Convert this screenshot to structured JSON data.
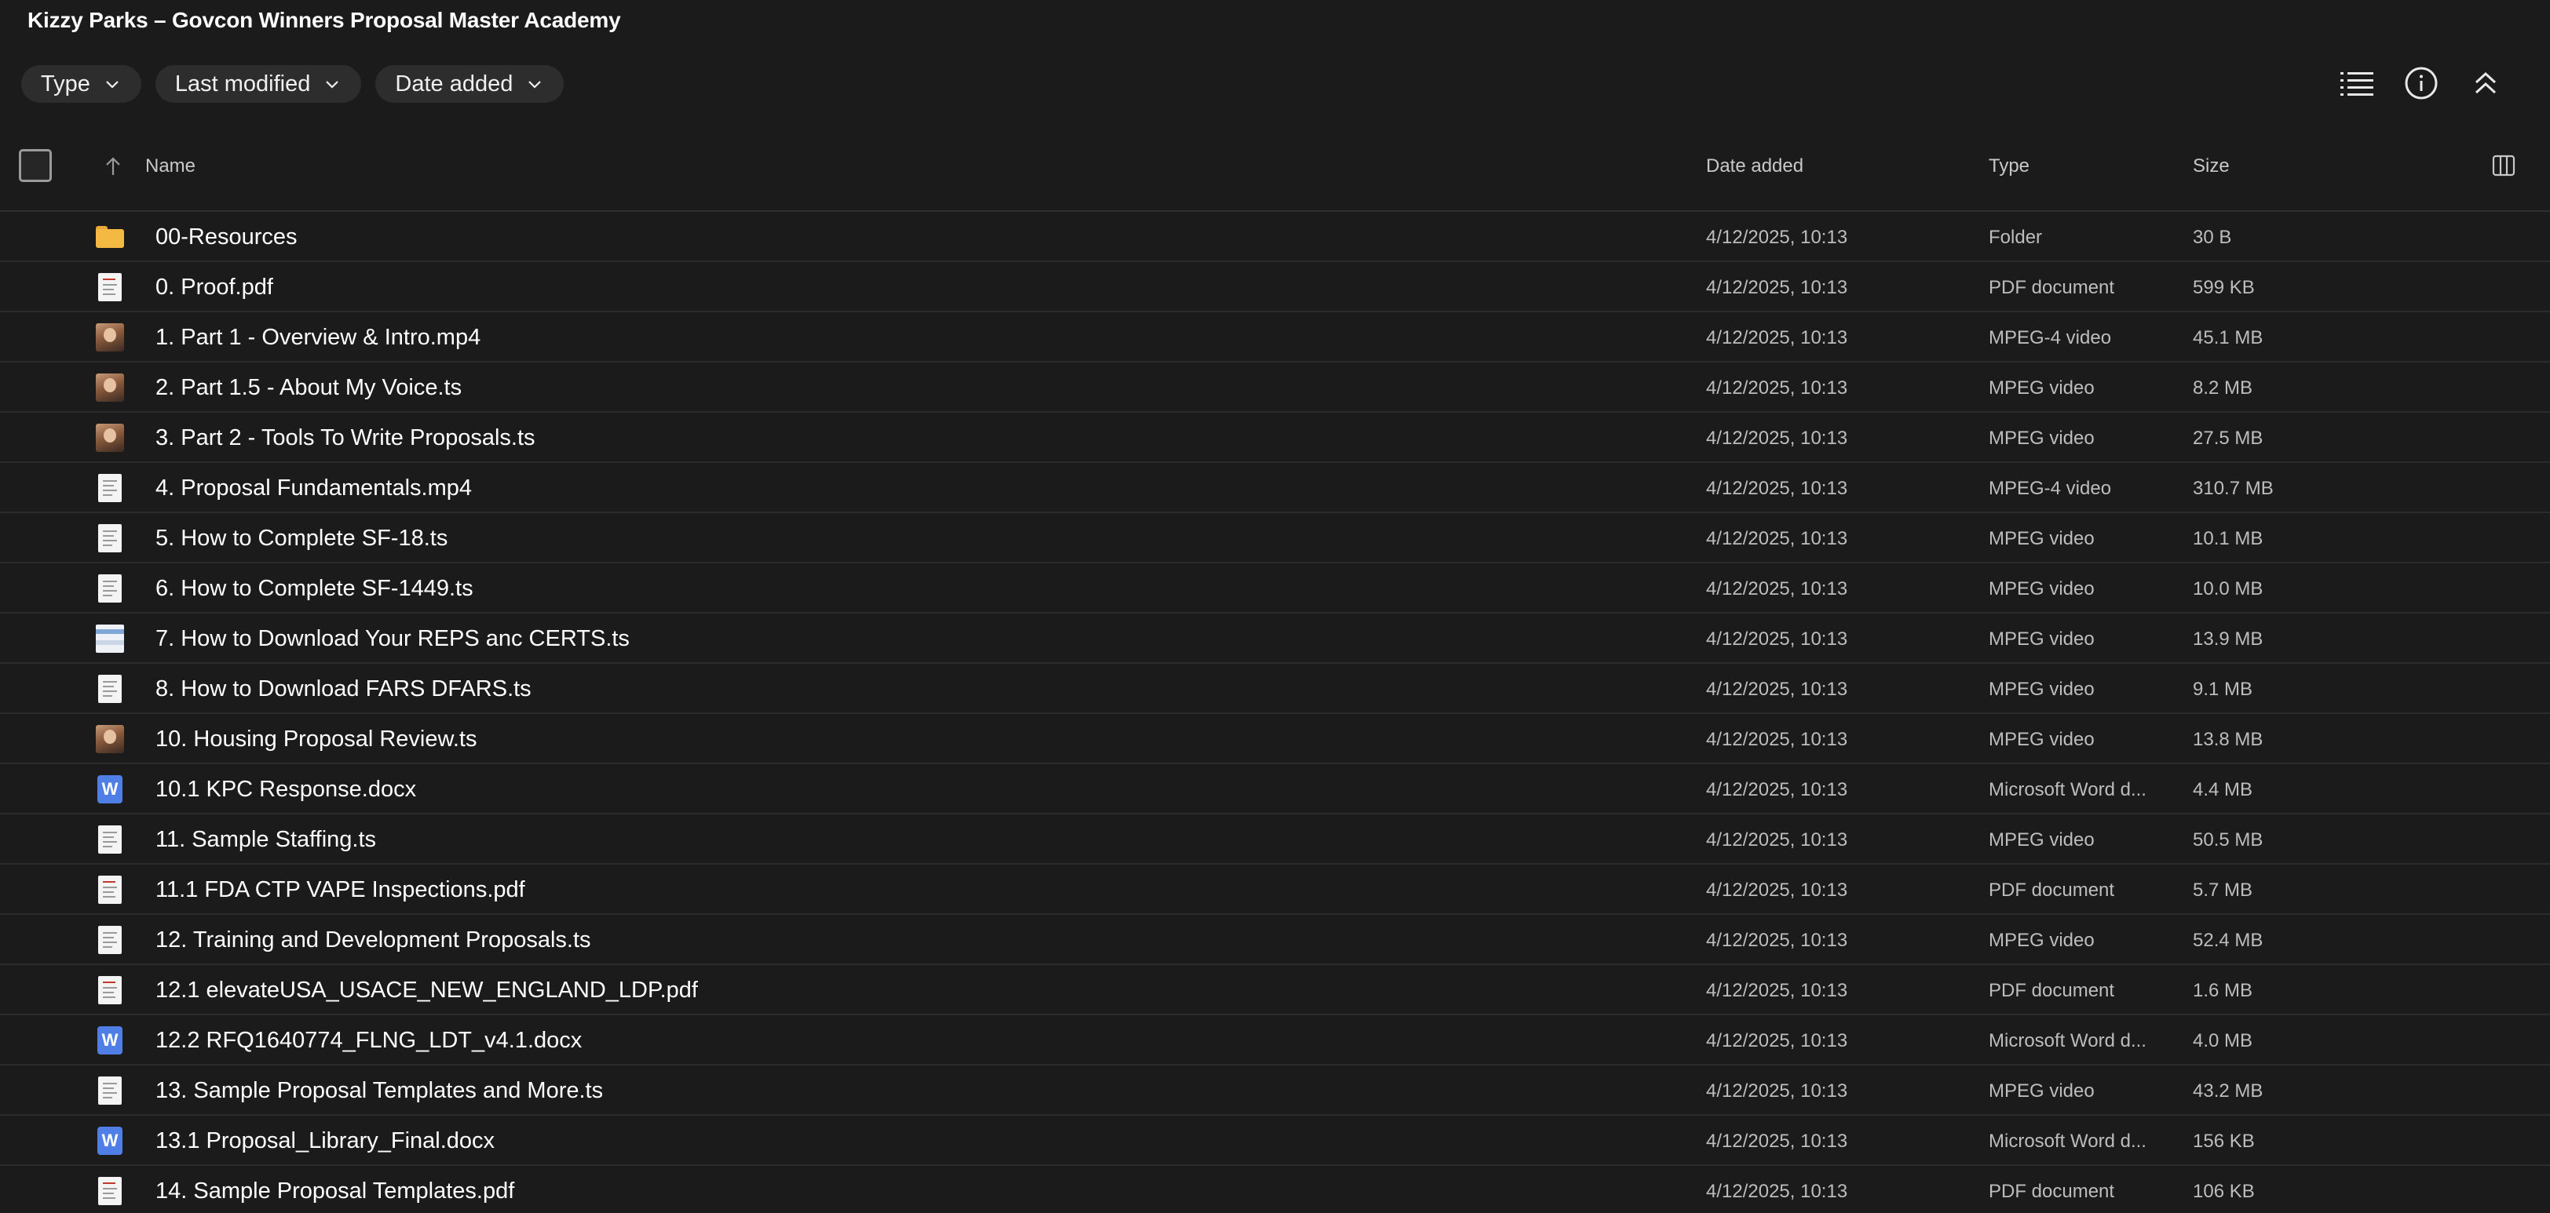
{
  "title": "Kizzy Parks – Govcon Winners Proposal Master Academy",
  "filters": [
    {
      "label": "Type"
    },
    {
      "label": "Last modified"
    },
    {
      "label": "Date added"
    }
  ],
  "columns": {
    "name": "Name",
    "date_added": "Date added",
    "type": "Type",
    "size": "Size"
  },
  "rows": [
    {
      "icon": "folder-icon",
      "name": "00-Resources",
      "date": "4/12/2025, 10:13",
      "type": "Folder",
      "size": "30 B"
    },
    {
      "icon": "pdf-thumbnail-icon",
      "name": "0. Proof.pdf",
      "date": "4/12/2025, 10:13",
      "type": "PDF document",
      "size": "599 KB"
    },
    {
      "icon": "video-thumbnail-icon",
      "name": "1. Part 1 - Overview & Intro.mp4",
      "date": "4/12/2025, 10:13",
      "type": "MPEG-4 video",
      "size": "45.1 MB"
    },
    {
      "icon": "video-thumbnail-icon",
      "name": "2. Part 1.5 - About My Voice.ts",
      "date": "4/12/2025, 10:13",
      "type": "MPEG video",
      "size": "8.2 MB"
    },
    {
      "icon": "video-thumbnail-icon",
      "name": "3. Part 2 - Tools To Write Proposals.ts",
      "date": "4/12/2025, 10:13",
      "type": "MPEG video",
      "size": "27.5 MB"
    },
    {
      "icon": "document-thumbnail-icon",
      "name": "4. Proposal Fundamentals.mp4",
      "date": "4/12/2025, 10:13",
      "type": "MPEG-4 video",
      "size": "310.7 MB"
    },
    {
      "icon": "document-thumbnail-icon",
      "name": "5. How to Complete SF-18.ts",
      "date": "4/12/2025, 10:13",
      "type": "MPEG video",
      "size": "10.1 MB"
    },
    {
      "icon": "document-thumbnail-icon",
      "name": "6. How to Complete SF-1449.ts",
      "date": "4/12/2025, 10:13",
      "type": "MPEG video",
      "size": "10.0 MB"
    },
    {
      "icon": "screenshot-thumbnail-icon",
      "name": "7. How to Download Your REPS anc CERTS.ts",
      "date": "4/12/2025, 10:13",
      "type": "MPEG video",
      "size": "13.9 MB"
    },
    {
      "icon": "document-thumbnail-icon",
      "name": "8. How to Download FARS DFARS.ts",
      "date": "4/12/2025, 10:13",
      "type": "MPEG video",
      "size": "9.1 MB"
    },
    {
      "icon": "video-thumbnail-icon",
      "name": "10. Housing Proposal Review.ts",
      "date": "4/12/2025, 10:13",
      "type": "MPEG video",
      "size": "13.8 MB"
    },
    {
      "icon": "word-icon",
      "name": "10.1 KPC Response.docx",
      "date": "4/12/2025, 10:13",
      "type": "Microsoft Word d...",
      "size": "4.4 MB"
    },
    {
      "icon": "document-thumbnail-icon",
      "name": "11. Sample Staffing.ts",
      "date": "4/12/2025, 10:13",
      "type": "MPEG video",
      "size": "50.5 MB"
    },
    {
      "icon": "pdf-thumbnail-icon",
      "name": "11.1 FDA CTP VAPE Inspections.pdf",
      "date": "4/12/2025, 10:13",
      "type": "PDF document",
      "size": "5.7 MB"
    },
    {
      "icon": "document-thumbnail-icon",
      "name": "12. Training and Development Proposals.ts",
      "date": "4/12/2025, 10:13",
      "type": "MPEG video",
      "size": "52.4 MB"
    },
    {
      "icon": "pdf-thumbnail-icon",
      "name": "12.1 elevateUSA_USACE_NEW_ENGLAND_LDP.pdf",
      "date": "4/12/2025, 10:13",
      "type": "PDF document",
      "size": "1.6 MB"
    },
    {
      "icon": "word-icon",
      "name": "12.2 RFQ1640774_FLNG_LDT_v4.1.docx",
      "date": "4/12/2025, 10:13",
      "type": "Microsoft Word d...",
      "size": "4.0 MB"
    },
    {
      "icon": "document-thumbnail-icon",
      "name": "13. Sample Proposal Templates and More.ts",
      "date": "4/12/2025, 10:13",
      "type": "MPEG video",
      "size": "43.2 MB"
    },
    {
      "icon": "word-icon",
      "name": "13.1 Proposal_Library_Final.docx",
      "date": "4/12/2025, 10:13",
      "type": "Microsoft Word d...",
      "size": "156 KB"
    },
    {
      "icon": "pdf-thumbnail-icon",
      "name": "14. Sample Proposal Templates.pdf",
      "date": "4/12/2025, 10:13",
      "type": "PDF document",
      "size": "106 KB"
    }
  ],
  "word_icon_letter": "W",
  "colors": {
    "background": "#1b1b1b",
    "chip": "#2d2d2d",
    "folder": "#f4b942",
    "word": "#4f7fe6"
  }
}
